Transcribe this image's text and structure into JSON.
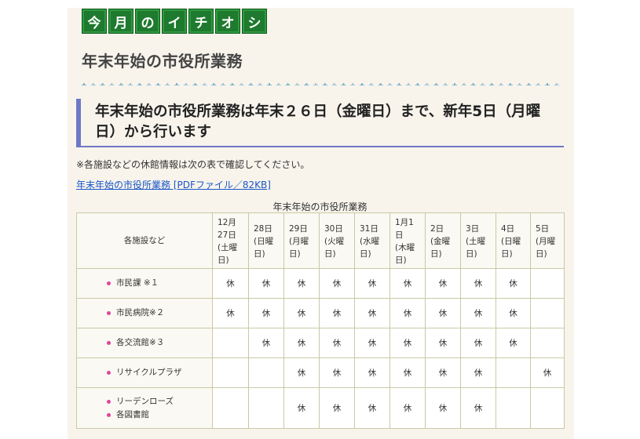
{
  "banner": {
    "tiles": [
      "今",
      "月",
      "の",
      "イ",
      "チ",
      "オ",
      "シ"
    ],
    "tile_color": "#1e7a2e"
  },
  "section_title": "年末年始の市役所業務",
  "headline": {
    "line1": "年末年始の市役所業務は年末２６日（金曜日）まで、新年5日（月曜",
    "line2": "日）から行います",
    "accent_color": "#6d79c6"
  },
  "note": "※各施設などの休館情報は次の表で確認してください。",
  "pdf_link": "年末年始の市役所業務 [PDFファイル／82KB]",
  "table": {
    "caption": "年末年始の市役所業務",
    "corner_header": "各施設など",
    "date_headers": [
      [
        "12月",
        "27日",
        "(土曜",
        "日)"
      ],
      [
        "28日",
        "(日曜",
        "日)"
      ],
      [
        "29日",
        "(月曜",
        "日)"
      ],
      [
        "30日",
        "(火曜",
        "日)"
      ],
      [
        "31日",
        "(水曜",
        "日)"
      ],
      [
        "1月1",
        "日",
        "(木曜",
        "日)"
      ],
      [
        "2日",
        "(金曜",
        "日)"
      ],
      [
        "3日",
        "(土曜",
        "日)"
      ],
      [
        "4日",
        "(日曜",
        "日)"
      ],
      [
        "5日",
        "(月曜",
        "日)"
      ]
    ],
    "rows": [
      {
        "facilities": [
          "市民課 ※１"
        ],
        "cells": [
          "休",
          "休",
          "休",
          "休",
          "休",
          "休",
          "休",
          "休",
          "休",
          ""
        ]
      },
      {
        "facilities": [
          "市民病院※２"
        ],
        "cells": [
          "休",
          "休",
          "休",
          "休",
          "休",
          "休",
          "休",
          "休",
          "休",
          ""
        ]
      },
      {
        "facilities": [
          "各交流館※３"
        ],
        "cells": [
          "",
          "休",
          "休",
          "休",
          "休",
          "休",
          "休",
          "休",
          "休",
          ""
        ]
      },
      {
        "facilities": [
          "リサイクルプラザ"
        ],
        "cells": [
          "",
          "",
          "休",
          "休",
          "休",
          "休",
          "休",
          "休",
          "",
          "休"
        ]
      },
      {
        "facilities": [
          "リーデンローズ",
          "各図書館"
        ],
        "cells": [
          "",
          "",
          "休",
          "休",
          "休",
          "休",
          "休",
          "休",
          "",
          ""
        ]
      }
    ],
    "bullet_color": "#e0449a"
  }
}
